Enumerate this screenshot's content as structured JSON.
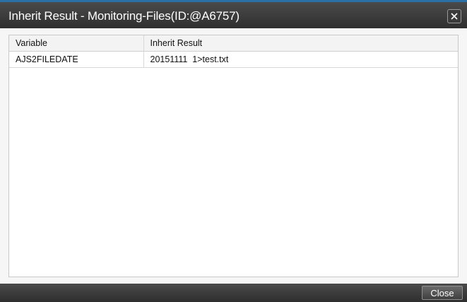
{
  "window": {
    "title": "Inherit Result - Monitoring-Files(ID:@A6757)"
  },
  "table": {
    "columns": [
      "Variable",
      "Inherit Result"
    ],
    "rows": [
      [
        "AJS2FILEDATE",
        "20151111  1>test.txt"
      ]
    ]
  },
  "footer": {
    "close_label": "Close"
  },
  "icons": {
    "close": "close-icon"
  },
  "colors": {
    "titlebar_accent": "#2a6fa5",
    "titlebar_bg": "#3b3b3b"
  }
}
